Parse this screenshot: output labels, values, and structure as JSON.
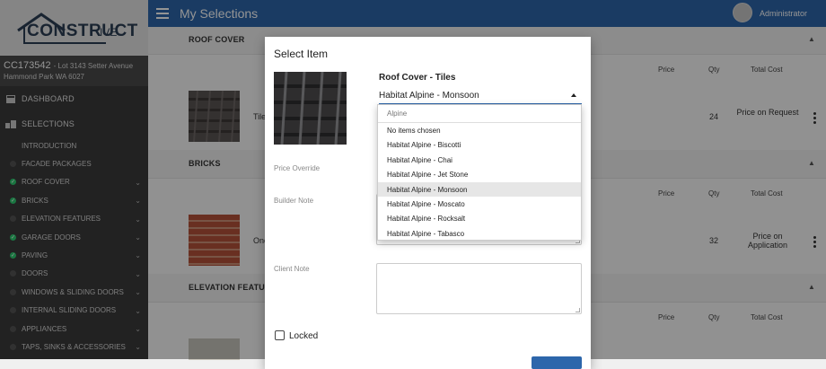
{
  "brand": {
    "logo_main": "CONSTRUCT",
    "logo_suffix": "IVE"
  },
  "job": {
    "code": "CC173542",
    "address_line1": "- Lot 3143 Setter Avenue",
    "address_line2": "Hammond Park WA 6027"
  },
  "sidebar": {
    "dashboard": "DASHBOARD",
    "selections": "SELECTIONS",
    "items": [
      {
        "label": "INTRODUCTION",
        "status": "none"
      },
      {
        "label": "FACADE PACKAGES",
        "status": "empty"
      },
      {
        "label": "ROOF COVER",
        "status": "done"
      },
      {
        "label": "BRICKS",
        "status": "done"
      },
      {
        "label": "ELEVATION FEATURES",
        "status": "empty"
      },
      {
        "label": "GARAGE DOORS",
        "status": "done"
      },
      {
        "label": "PAVING",
        "status": "done"
      },
      {
        "label": "DOORS",
        "status": "empty"
      },
      {
        "label": "WINDOWS & SLIDING DOORS",
        "status": "empty"
      },
      {
        "label": "INTERNAL SLIDING DOORS",
        "status": "empty"
      },
      {
        "label": "APPLIANCES",
        "status": "empty"
      },
      {
        "label": "TAPS, SINKS & ACCESSORIES",
        "status": "empty"
      }
    ]
  },
  "header": {
    "title": "My Selections",
    "user": "Administrator"
  },
  "sections": {
    "roof": {
      "title": "ROOF COVER",
      "price_hdr": "Price",
      "qty_hdr": "Qty",
      "total_hdr": "Total Cost",
      "name_frag": "Tile",
      "qty": "24",
      "total": "Price on Request"
    },
    "bricks": {
      "title": "BRICKS",
      "price_hdr": "Price",
      "qty_hdr": "Qty",
      "total_hdr": "Total Cost",
      "name_frag": "One",
      "qty": "32",
      "total": "Price on Application"
    },
    "elevation": {
      "title": "ELEVATION FEATUR",
      "price_hdr": "Price",
      "qty_hdr": "Qty",
      "total_hdr": "Total Cost"
    }
  },
  "modal": {
    "title": "Select Item",
    "item_title": "Roof Cover - Tiles",
    "selected": "Habitat Alpine - Monsoon",
    "price_override_label": "Price Override",
    "builder_note_label": "Builder Note",
    "client_note_label": "Client Note",
    "locked_label": "Locked"
  },
  "dropdown": {
    "search_value": "Alpine",
    "options": [
      "No items chosen",
      "Habitat Alpine - Biscotti",
      "Habitat Alpine - Chai",
      "Habitat Alpine - Jet Stone",
      "Habitat Alpine - Monsoon",
      "Habitat Alpine - Moscato",
      "Habitat Alpine - Rocksalt",
      "Habitat Alpine - Tabasco"
    ],
    "selected_index": 4
  },
  "colors": {
    "primary": "#2d66ab",
    "sidebar": "#3b3b3b",
    "done": "#2ecc71"
  }
}
